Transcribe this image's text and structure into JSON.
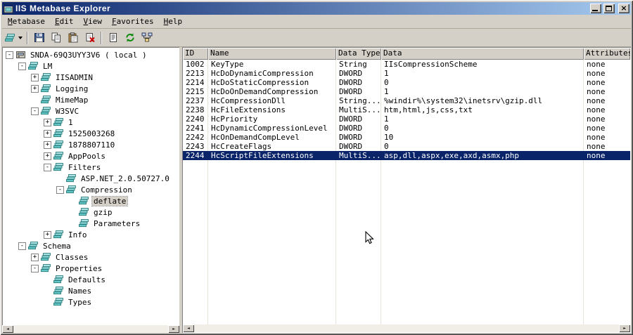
{
  "colors": {
    "chrome": "#d4d0c8",
    "titlebar_left": "#0a246a",
    "titlebar_right": "#a6caf0",
    "selection": "#0a246a",
    "grid_line": "#e7e4dc",
    "tree_icon_teal": "#7ed0d0"
  },
  "window": {
    "title": "IIS Metabase Explorer"
  },
  "icons": {
    "close": "×",
    "scroll_left": "◄",
    "scroll_right": "►"
  },
  "menu": {
    "items": [
      "Metabase",
      "Edit",
      "View",
      "Favorites",
      "Help"
    ]
  },
  "toolbar": {
    "buttons": [
      {
        "name": "new-record",
        "icon": "new-record-icon",
        "split": true
      },
      {
        "separator": true
      },
      {
        "name": "save",
        "icon": "save-icon"
      },
      {
        "name": "copy",
        "icon": "copy-icon"
      },
      {
        "name": "paste",
        "icon": "paste-icon"
      },
      {
        "name": "delete",
        "icon": "delete-icon"
      },
      {
        "separator": true
      },
      {
        "name": "properties",
        "icon": "properties-icon"
      },
      {
        "name": "refresh",
        "icon": "refresh-icon"
      },
      {
        "name": "connect",
        "icon": "connect-icon"
      }
    ]
  },
  "tree": {
    "nodes": [
      {
        "depth": 0,
        "expander": "minus",
        "icon": "computer-icon",
        "label": "SNDA-69Q3UYY3V6 ( local )",
        "selected": false
      },
      {
        "depth": 1,
        "expander": "minus",
        "icon": "key-icon",
        "label": "LM",
        "selected": false
      },
      {
        "depth": 2,
        "expander": "plus",
        "icon": "key-icon",
        "label": "IISADMIN",
        "selected": false
      },
      {
        "depth": 2,
        "expander": "plus",
        "icon": "key-icon",
        "label": "Logging",
        "selected": false
      },
      {
        "depth": 2,
        "expander": "none",
        "icon": "key-icon",
        "label": "MimeMap",
        "selected": false
      },
      {
        "depth": 2,
        "expander": "minus",
        "icon": "key-icon",
        "label": "W3SVC",
        "selected": false
      },
      {
        "depth": 3,
        "expander": "plus",
        "icon": "key-icon",
        "label": "1",
        "selected": false
      },
      {
        "depth": 3,
        "expander": "plus",
        "icon": "key-icon",
        "label": "1525003268",
        "selected": false
      },
      {
        "depth": 3,
        "expander": "plus",
        "icon": "key-icon",
        "label": "1878807110",
        "selected": false
      },
      {
        "depth": 3,
        "expander": "plus",
        "icon": "key-icon",
        "label": "AppPools",
        "selected": false
      },
      {
        "depth": 3,
        "expander": "minus",
        "icon": "key-icon",
        "label": "Filters",
        "selected": false
      },
      {
        "depth": 4,
        "expander": "none",
        "icon": "key-icon",
        "label": "ASP.NET_2.0.50727.0",
        "selected": false
      },
      {
        "depth": 4,
        "expander": "minus",
        "icon": "key-icon",
        "label": "Compression",
        "selected": false
      },
      {
        "depth": 5,
        "expander": "none",
        "icon": "key-icon",
        "label": "deflate",
        "selected": true
      },
      {
        "depth": 5,
        "expander": "none",
        "icon": "key-icon",
        "label": "gzip",
        "selected": false
      },
      {
        "depth": 5,
        "expander": "none",
        "icon": "key-icon",
        "label": "Parameters",
        "selected": false
      },
      {
        "depth": 3,
        "expander": "plus",
        "icon": "key-icon",
        "label": "Info",
        "selected": false
      },
      {
        "depth": 1,
        "expander": "minus",
        "icon": "key-icon",
        "label": "Schema",
        "selected": false
      },
      {
        "depth": 2,
        "expander": "plus",
        "icon": "key-icon",
        "label": "Classes",
        "selected": false
      },
      {
        "depth": 2,
        "expander": "minus",
        "icon": "key-icon",
        "label": "Properties",
        "selected": false
      },
      {
        "depth": 3,
        "expander": "none",
        "icon": "key-icon",
        "label": "Defaults",
        "selected": false
      },
      {
        "depth": 3,
        "expander": "none",
        "icon": "key-icon",
        "label": "Names",
        "selected": false
      },
      {
        "depth": 3,
        "expander": "none",
        "icon": "key-icon",
        "label": "Types",
        "selected": false
      }
    ]
  },
  "list": {
    "columns": [
      "ID",
      "Name",
      "Data Type",
      "Data",
      "Attributes"
    ],
    "rows": [
      {
        "cells": [
          "1002",
          "KeyType",
          "String",
          "IIsCompressionScheme",
          "none"
        ],
        "selected": false
      },
      {
        "cells": [
          "2213",
          "HcDoDynamicCompression",
          "DWORD",
          "1",
          "none"
        ],
        "selected": false
      },
      {
        "cells": [
          "2214",
          "HcDoStaticCompression",
          "DWORD",
          "0",
          "none"
        ],
        "selected": false
      },
      {
        "cells": [
          "2215",
          "HcDoOnDemandCompression",
          "DWORD",
          "1",
          "none"
        ],
        "selected": false
      },
      {
        "cells": [
          "2237",
          "HcCompressionDll",
          "String...",
          "%windir%\\system32\\inetsrv\\gzip.dll",
          "none"
        ],
        "selected": false
      },
      {
        "cells": [
          "2238",
          "HcFileExtensions",
          "MultiS...",
          "htm,html,js,css,txt",
          "none"
        ],
        "selected": false
      },
      {
        "cells": [
          "2240",
          "HcPriority",
          "DWORD",
          "1",
          "none"
        ],
        "selected": false
      },
      {
        "cells": [
          "2241",
          "HcDynamicCompressionLevel",
          "DWORD",
          "0",
          "none"
        ],
        "selected": false
      },
      {
        "cells": [
          "2242",
          "HcOnDemandCompLevel",
          "DWORD",
          "10",
          "none"
        ],
        "selected": false
      },
      {
        "cells": [
          "2243",
          "HcCreateFlags",
          "DWORD",
          "0",
          "none"
        ],
        "selected": false
      },
      {
        "cells": [
          "2244",
          "HcScriptFileExtensions",
          "MultiS...",
          "asp,dll,aspx,exe,axd,asmx,php",
          "none"
        ],
        "selected": true
      }
    ]
  }
}
